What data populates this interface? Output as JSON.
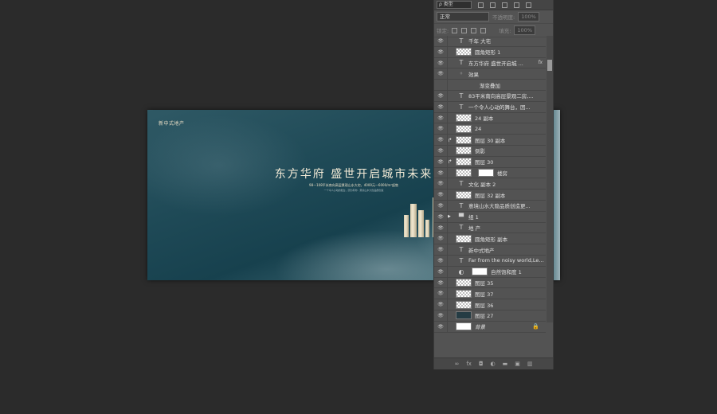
{
  "panel": {
    "filter_kind": "ρ 类型",
    "blend_mode": "正常",
    "opacity_label": "不透明度:",
    "opacity_value": "100%",
    "lock_label": "锁定:",
    "fill_label": "填充:",
    "fill_value": "100%"
  },
  "canvas": {
    "brand": "新中式地产",
    "headline": "东方华府  盛世开启城市未来",
    "subline": "98—108平米南向高层景观山水大宅，4000元—6000/m²起售",
    "tagline": "一个令人心动的舞台，因为有你 · 意境山水大隐品质创造"
  },
  "layers": [
    {
      "name": "千年 大宅",
      "kind": "text"
    },
    {
      "name": "圆角矩形 1",
      "kind": "shape"
    },
    {
      "name": "东方华府 盛世开启城 ...",
      "kind": "text",
      "fx": "fx"
    },
    {
      "name": "效果",
      "kind": "effect"
    },
    {
      "name": "渐变叠加",
      "kind": "effect-item"
    },
    {
      "name": "83平米南向高层景观二房,...",
      "kind": "text"
    },
    {
      "name": "一个令人心动的舞台，因...",
      "kind": "text"
    },
    {
      "name": "24 副本",
      "kind": "shape"
    },
    {
      "name": "24",
      "kind": "shape"
    },
    {
      "name": "图层 30 副本",
      "kind": "clip"
    },
    {
      "name": "倒影",
      "kind": "shape"
    },
    {
      "name": "图层 30",
      "kind": "clip"
    },
    {
      "name": "楼房",
      "kind": "masked"
    },
    {
      "name": "文化 副本 2",
      "kind": "text"
    },
    {
      "name": "图层 32 副本",
      "kind": "shape"
    },
    {
      "name": "意境山水大隐品质创造更...",
      "kind": "text"
    },
    {
      "name": "组 1",
      "kind": "group"
    },
    {
      "name": "地 产",
      "kind": "text"
    },
    {
      "name": "圆角矩形 副本",
      "kind": "shape"
    },
    {
      "name": "新中式地产",
      "kind": "text"
    },
    {
      "name": "Far from the noisy world,Let...",
      "kind": "text"
    },
    {
      "name": "自然饱和度 1",
      "kind": "adjust"
    },
    {
      "name": "图层 35",
      "kind": "shape"
    },
    {
      "name": "图层 37",
      "kind": "shape"
    },
    {
      "name": "图层 36",
      "kind": "shape"
    },
    {
      "name": "图层 27",
      "kind": "dark"
    },
    {
      "name": "背景",
      "kind": "background"
    }
  ],
  "icons": {
    "eye": "eye-icon",
    "text": "text-layer-icon",
    "folder": "folder-icon",
    "lock": "lock-icon"
  }
}
